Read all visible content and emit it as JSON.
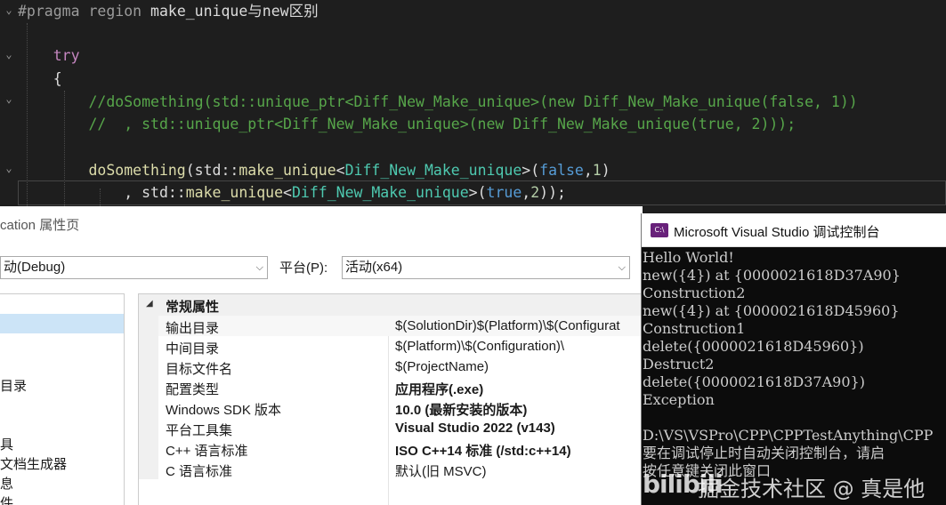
{
  "editor": {
    "lines": [
      {
        "segments": [
          {
            "cls": "c-pp",
            "text": "#pragma region "
          },
          {
            "cls": "c-tx",
            "text": "make_unique与new区别"
          }
        ]
      },
      {
        "segments": [
          {
            "cls": "c-kw",
            "text": "    try"
          }
        ]
      },
      {
        "segments": [
          {
            "cls": "c-tx",
            "text": "    {"
          }
        ]
      },
      {
        "segments": [
          {
            "cls": "c-cm",
            "text": "        //doSomething(std::unique_ptr<Diff_New_Make_unique>(new Diff_New_Make_unique(false, 1))"
          }
        ]
      },
      {
        "segments": [
          {
            "cls": "c-cm",
            "text": "        //  , std::unique_ptr<Diff_New_Make_unique>(new Diff_New_Make_unique(true, 2)));"
          }
        ]
      },
      {
        "segments": [
          {
            "cls": "c-tx",
            "text": ""
          }
        ]
      },
      {
        "segments": [
          {
            "cls": "c-fn",
            "text": "        doSomething"
          },
          {
            "cls": "c-tx",
            "text": "(std::"
          },
          {
            "cls": "c-fn",
            "text": "make_unique"
          },
          {
            "cls": "c-tx",
            "text": "<"
          },
          {
            "cls": "c-ty",
            "text": "Diff_New_Make_unique"
          },
          {
            "cls": "c-tx",
            "text": ">("
          },
          {
            "cls": "c-bl",
            "text": "false"
          },
          {
            "cls": "c-tx",
            "text": ","
          },
          {
            "cls": "c-nm",
            "text": "1"
          },
          {
            "cls": "c-tx",
            "text": ")"
          }
        ]
      },
      {
        "segments": [
          {
            "cls": "c-tx",
            "text": "            , std::"
          },
          {
            "cls": "c-fn",
            "text": "make_unique"
          },
          {
            "cls": "c-tx",
            "text": "<"
          },
          {
            "cls": "c-ty",
            "text": "Diff_New_Make_unique"
          },
          {
            "cls": "c-tx",
            "text": ">("
          },
          {
            "cls": "c-bl",
            "text": "true"
          },
          {
            "cls": "c-tx",
            "text": ","
          },
          {
            "cls": "c-nm",
            "text": "2"
          },
          {
            "cls": "c-tx",
            "text": "));"
          }
        ]
      }
    ]
  },
  "dialog": {
    "title": "cation 属性页",
    "config_value": "动(Debug)",
    "platform_label": "平台(P):",
    "platform_value": "活动(x64)",
    "tree_items": [
      "目录",
      "具",
      "文档生成器",
      "息",
      "件"
    ],
    "section_header": "常规属性",
    "properties": [
      {
        "name": "输出目录",
        "value": "$(SolutionDir)$(Platform)\\$(Configurat",
        "bold": false
      },
      {
        "name": "中间目录",
        "value": "$(Platform)\\$(Configuration)\\",
        "bold": false
      },
      {
        "name": "目标文件名",
        "value": "$(ProjectName)",
        "bold": false
      },
      {
        "name": "配置类型",
        "value": "应用程序(.exe)",
        "bold": true
      },
      {
        "name": "Windows SDK 版本",
        "value": "10.0 (最新安装的版本)",
        "bold": true
      },
      {
        "name": "平台工具集",
        "value": "Visual Studio 2022 (v143)",
        "bold": true
      },
      {
        "name": "C++ 语言标准",
        "value": "ISO C++14 标准 (/std:c++14)",
        "bold": true
      },
      {
        "name": "C 语言标准",
        "value": "默认(旧 MSVC)",
        "bold": false
      }
    ]
  },
  "console": {
    "icon_text": "C:\\",
    "title": "Microsoft Visual Studio 调试控制台",
    "lines": [
      "Hello World!",
      "new({4}) at {0000021618D37A90}",
      "Construction2",
      "new({4}) at {0000021618D45960}",
      "Construction1",
      "delete({0000021618D45960})",
      "Destruct2",
      "delete({0000021618D37A90})",
      "Exception",
      "",
      "D:\\VS\\VSPro\\CPP\\CPPTestAnything\\CPP",
      "要在调试停止时自动关闭控制台，请启",
      "按任意键关闭此窗口"
    ]
  },
  "watermark": {
    "logo": "bilibili",
    "text": "掘金技术社区 @ 真是他"
  },
  "icons": {
    "fold_arrow": "chevron-down-icon",
    "dropdown_arrow": "chevron-down-icon",
    "section_triangle": "triangle-down-icon",
    "console_app": "console-app-icon"
  }
}
